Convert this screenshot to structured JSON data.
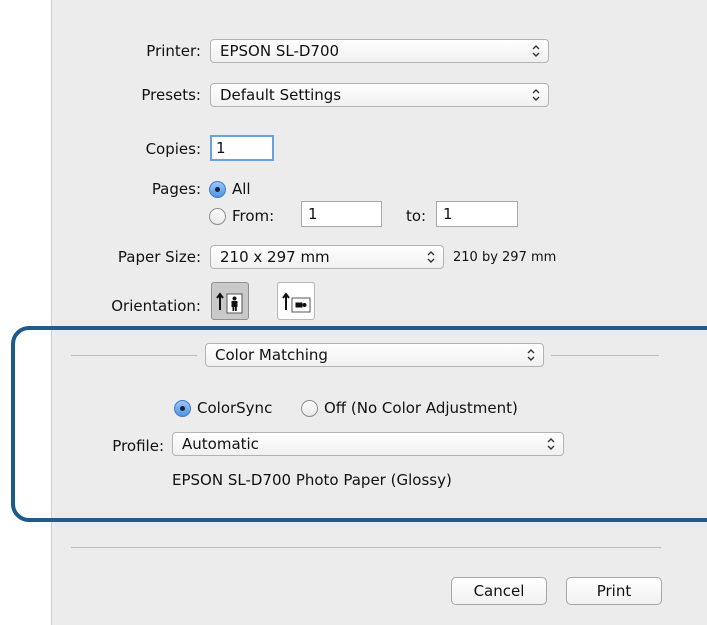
{
  "printer": {
    "label": "Printer:",
    "value": "EPSON SL-D700"
  },
  "presets": {
    "label": "Presets:",
    "value": "Default Settings"
  },
  "copies": {
    "label": "Copies:",
    "value": "1"
  },
  "pages": {
    "label": "Pages:",
    "all_label": "All",
    "from_label": "From:",
    "from_value": "1",
    "to_label": "to:",
    "to_value": "1",
    "selected": "All"
  },
  "paper_size": {
    "label": "Paper Size:",
    "value": "210 x 297 mm",
    "description": "210 by 297 mm"
  },
  "orientation": {
    "label": "Orientation:",
    "selected": "portrait"
  },
  "section": {
    "value": "Color Matching"
  },
  "color_matching": {
    "colorsync_label": "ColorSync",
    "off_label": "Off (No Color Adjustment)",
    "selected": "ColorSync",
    "profile_label": "Profile:",
    "profile_value": "Automatic",
    "profile_description": "EPSON SL-D700 Photo Paper (Glossy)"
  },
  "buttons": {
    "cancel": "Cancel",
    "print": "Print"
  },
  "colors": {
    "dialog_background": "#ececec",
    "highlight_frame": "#1e5a8c",
    "focus_ring": "#6aa1e2",
    "radio_selected": "#4f93e6"
  },
  "icons": {
    "popup_arrows": "updown-chevron-icon",
    "portrait": "portrait-orientation-icon",
    "landscape": "landscape-orientation-icon"
  }
}
